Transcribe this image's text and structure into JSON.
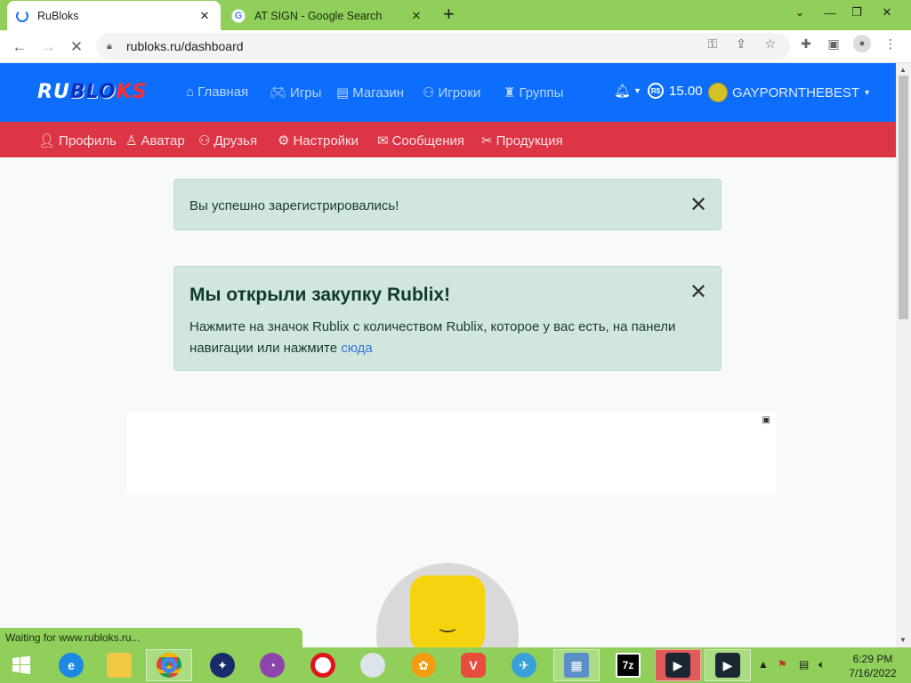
{
  "browser": {
    "tabs": [
      {
        "title": "RuBloks",
        "active": true
      },
      {
        "title": "AT SIGN - Google Search",
        "active": false
      }
    ],
    "address": "rubloks.ru/dashboard",
    "status": "Waiting for www.rubloks.ru..."
  },
  "site": {
    "logo": {
      "part1": "RU",
      "part2": "BLO",
      "part3": "KS"
    },
    "nav_main": [
      {
        "label": "Главная",
        "icon": "home-icon"
      },
      {
        "label": "Игры",
        "icon": "gamepad-icon"
      },
      {
        "label": "Магазин",
        "icon": "shop-icon"
      },
      {
        "label": "Игроки",
        "icon": "users-icon"
      },
      {
        "label": "Группы",
        "icon": "group-icon"
      }
    ],
    "balance": "15.00",
    "currency_badge": "R$",
    "username": "GAYPORNTHEBEST",
    "nav_sub": [
      {
        "label": "Профиль",
        "icon": "person-icon"
      },
      {
        "label": "Аватар",
        "icon": "avatar-icon"
      },
      {
        "label": "Друзья",
        "icon": "friends-icon"
      },
      {
        "label": "Настройки",
        "icon": "gear-icon"
      },
      {
        "label": "Сообщения",
        "icon": "envelope-icon"
      },
      {
        "label": "Продукция",
        "icon": "tools-icon"
      }
    ]
  },
  "alerts": {
    "success": "Вы успешно зарегистрировались!",
    "promo_heading": "Мы открыли закупку Rublix!",
    "promo_body": "Нажмите на значок Rublix с количеством Rublix, которое у вас есть, на панели навигации или нажмите",
    "promo_link": "сюда"
  },
  "colors": {
    "nav_primary": "#0d6efd",
    "nav_secondary": "#dc3545",
    "alert_bg": "#d1e7dd",
    "chrome_frame": "#8fcf5a"
  },
  "taskbar": {
    "time": "6:29 PM",
    "date": "7/16/2022",
    "apps": [
      "internet-explorer-icon",
      "file-explorer-icon",
      "chrome-icon",
      "app-icon",
      "browser-icon",
      "opera-icon",
      "app-icon",
      "uc-browser-icon",
      "vivaldi-icon",
      "app-icon",
      "control-panel-icon",
      "7zip-icon",
      "filmora-icon",
      "filmora-icon"
    ]
  }
}
